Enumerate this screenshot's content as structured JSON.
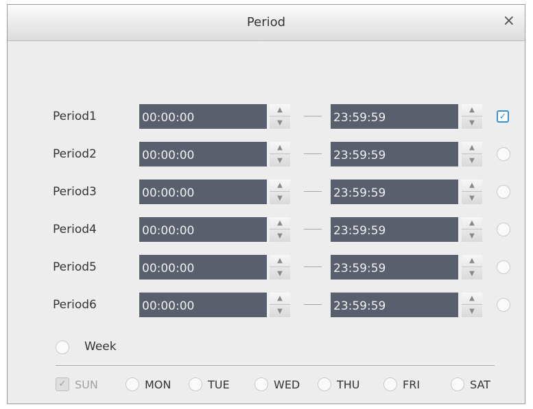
{
  "dialog": {
    "title": "Period",
    "close_glyph": "×"
  },
  "periods": [
    {
      "label": "Period1",
      "start": "00:00:00",
      "end": "23:59:59",
      "selected": true
    },
    {
      "label": "Period2",
      "start": "00:00:00",
      "end": "23:59:59",
      "selected": false
    },
    {
      "label": "Period3",
      "start": "00:00:00",
      "end": "23:59:59",
      "selected": false
    },
    {
      "label": "Period4",
      "start": "00:00:00",
      "end": "23:59:59",
      "selected": false
    },
    {
      "label": "Period5",
      "start": "00:00:00",
      "end": "23:59:59",
      "selected": false
    },
    {
      "label": "Period6",
      "start": "00:00:00",
      "end": "23:59:59",
      "selected": false
    }
  ],
  "week": {
    "label": "Week",
    "selected": false
  },
  "days": [
    {
      "label": "SUN",
      "checked": true,
      "disabled": true
    },
    {
      "label": "MON",
      "checked": false,
      "disabled": false
    },
    {
      "label": "TUE",
      "checked": false,
      "disabled": false
    },
    {
      "label": "WED",
      "checked": false,
      "disabled": false
    },
    {
      "label": "THU",
      "checked": false,
      "disabled": false
    },
    {
      "label": "FRI",
      "checked": false,
      "disabled": false
    },
    {
      "label": "SAT",
      "checked": false,
      "disabled": false
    }
  ],
  "icons": {
    "check": "✓",
    "spin_up": "▲",
    "spin_down": "▼"
  },
  "colors": {
    "field_bg": "#5a5f6d",
    "accent": "#3a8fd0"
  }
}
